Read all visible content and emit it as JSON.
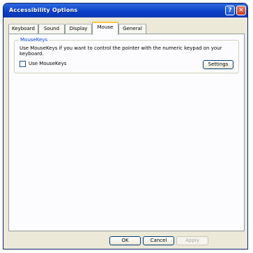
{
  "window": {
    "title": "Accessibility Options",
    "help_symbol": "?",
    "close_symbol": "✕"
  },
  "tabs": [
    {
      "label": "Keyboard"
    },
    {
      "label": "Sound"
    },
    {
      "label": "Display"
    },
    {
      "label": "Mouse"
    },
    {
      "label": "General"
    }
  ],
  "active_tab": "Mouse",
  "mousekeys": {
    "group_title": "MouseKeys",
    "description": "Use MouseKeys if you want to control the pointer with the numeric keypad on your keyboard.",
    "checkbox_label": "Use MouseKeys",
    "checkbox_checked": false,
    "settings_label": "Settings"
  },
  "footer": {
    "ok_label": "OK",
    "cancel_label": "Cancel",
    "apply_label": "Apply"
  },
  "colors": {
    "title_bar": "#0a3fc8",
    "group_title": "#0046d5",
    "active_tab_highlight": "#ffc83c"
  }
}
